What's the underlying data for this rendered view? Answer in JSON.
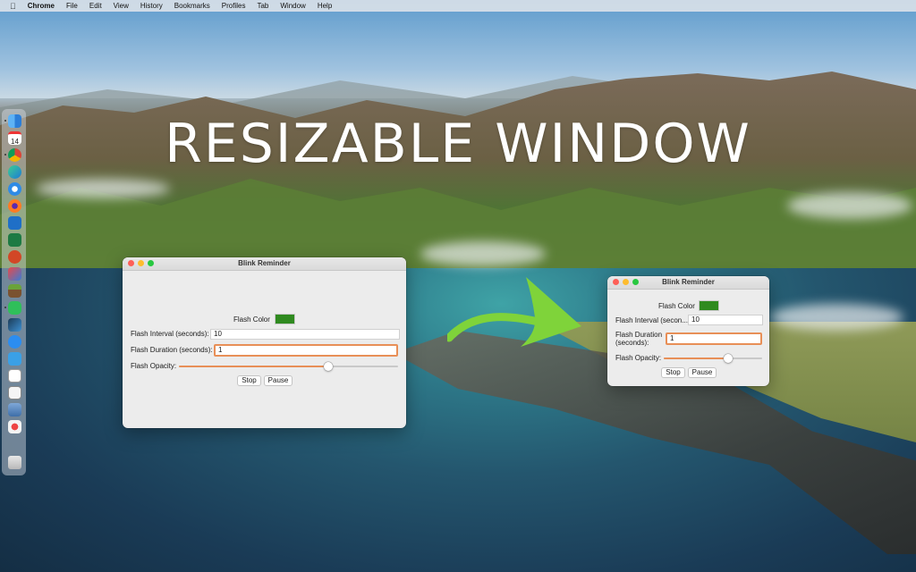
{
  "menubar": {
    "app": "Chrome",
    "items": [
      "File",
      "Edit",
      "View",
      "History",
      "Bookmarks",
      "Profiles",
      "Tab",
      "Window",
      "Help"
    ]
  },
  "headline": "RESIZABLE WINDOW",
  "dock": {
    "calendar_day": "14",
    "icons": [
      "finder-icon",
      "calendar-icon",
      "chrome-icon",
      "edge-icon",
      "safari-icon",
      "firefox-icon",
      "outlook-icon",
      "excel-icon",
      "powerpoint-icon",
      "screenshot-icon",
      "minecraft-icon",
      "cursor-icon",
      "xcode-icon",
      "app-store-icon",
      "finder-tool-icon",
      "scanner-icon",
      "preview-icon",
      "trash-icon"
    ]
  },
  "window_large": {
    "title": "Blink Reminder",
    "flash_color_label": "Flash Color",
    "flash_color": "#2f8a1f",
    "interval_label": "Flash Interval (seconds):",
    "interval_value": "10",
    "duration_label": "Flash Duration (seconds):",
    "duration_value": "1",
    "opacity_label": "Flash Opacity:",
    "opacity_level": 0.68,
    "stop_label": "Stop",
    "pause_label": "Pause"
  },
  "window_small": {
    "title": "Blink Reminder",
    "flash_color_label": "Flash Color",
    "flash_color": "#2f8a1f",
    "interval_label": "Flash Interval (secon...",
    "interval_value": "10",
    "duration_label_line1": "Flash Duration",
    "duration_label_line2": "(seconds):",
    "duration_value": "1",
    "opacity_label": "Flash Opacity:",
    "opacity_level": 0.65,
    "stop_label": "Stop",
    "pause_label": "Pause"
  },
  "colors": {
    "accent": "#e88f57",
    "arrow": "#7fd33a"
  }
}
